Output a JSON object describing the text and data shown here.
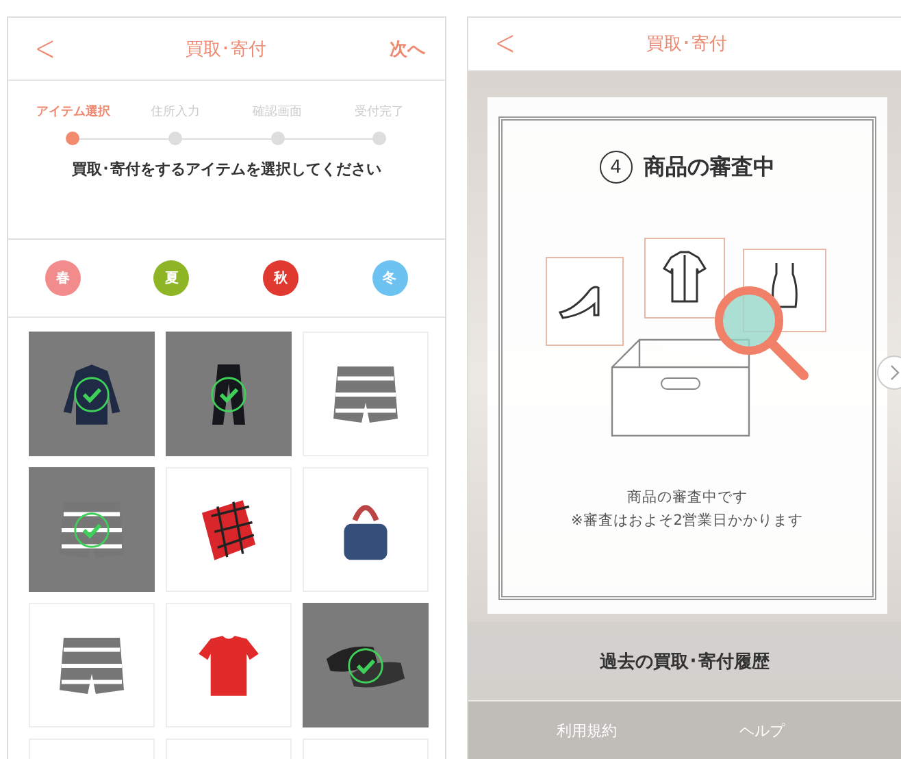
{
  "left_screen": {
    "header": {
      "back": "<",
      "title": "買取･寄付",
      "next": "次へ"
    },
    "steps": [
      {
        "label": "アイテム選択",
        "selected": true
      },
      {
        "label": "住所入力",
        "selected": false
      },
      {
        "label": "確認画面",
        "selected": false
      },
      {
        "label": "受付完了",
        "selected": false
      }
    ],
    "instruction": "買取･寄付をするアイテムを選択してください",
    "seasons": [
      {
        "label": "春",
        "color": "#f28b8b"
      },
      {
        "label": "夏",
        "color": "#8db526"
      },
      {
        "label": "秋",
        "color": "#e0392f"
      },
      {
        "label": "冬",
        "color": "#6cc3f2"
      }
    ],
    "items": [
      {
        "kind": "sweater",
        "selected": true
      },
      {
        "kind": "pants",
        "selected": true
      },
      {
        "kind": "shorts",
        "selected": false
      },
      {
        "kind": "shorts",
        "selected": true
      },
      {
        "kind": "scarf",
        "selected": false
      },
      {
        "kind": "bag",
        "selected": false
      },
      {
        "kind": "shorts",
        "selected": false
      },
      {
        "kind": "tshirt",
        "selected": false
      },
      {
        "kind": "shoes",
        "selected": true
      },
      {
        "kind": "other",
        "selected": false
      },
      {
        "kind": "other",
        "selected": false
      },
      {
        "kind": "other",
        "selected": false
      }
    ]
  },
  "right_screen": {
    "header": {
      "back": "<",
      "title": "買取･寄付"
    },
    "card": {
      "step_number": "4",
      "title": "商品の審査中",
      "message": "商品の審査中です",
      "note": "※審査はおよそ2営業日かかります"
    },
    "history_button": "過去の買取･寄付履歴",
    "footer_links": [
      "利用規約",
      "ヘルプ"
    ]
  }
}
